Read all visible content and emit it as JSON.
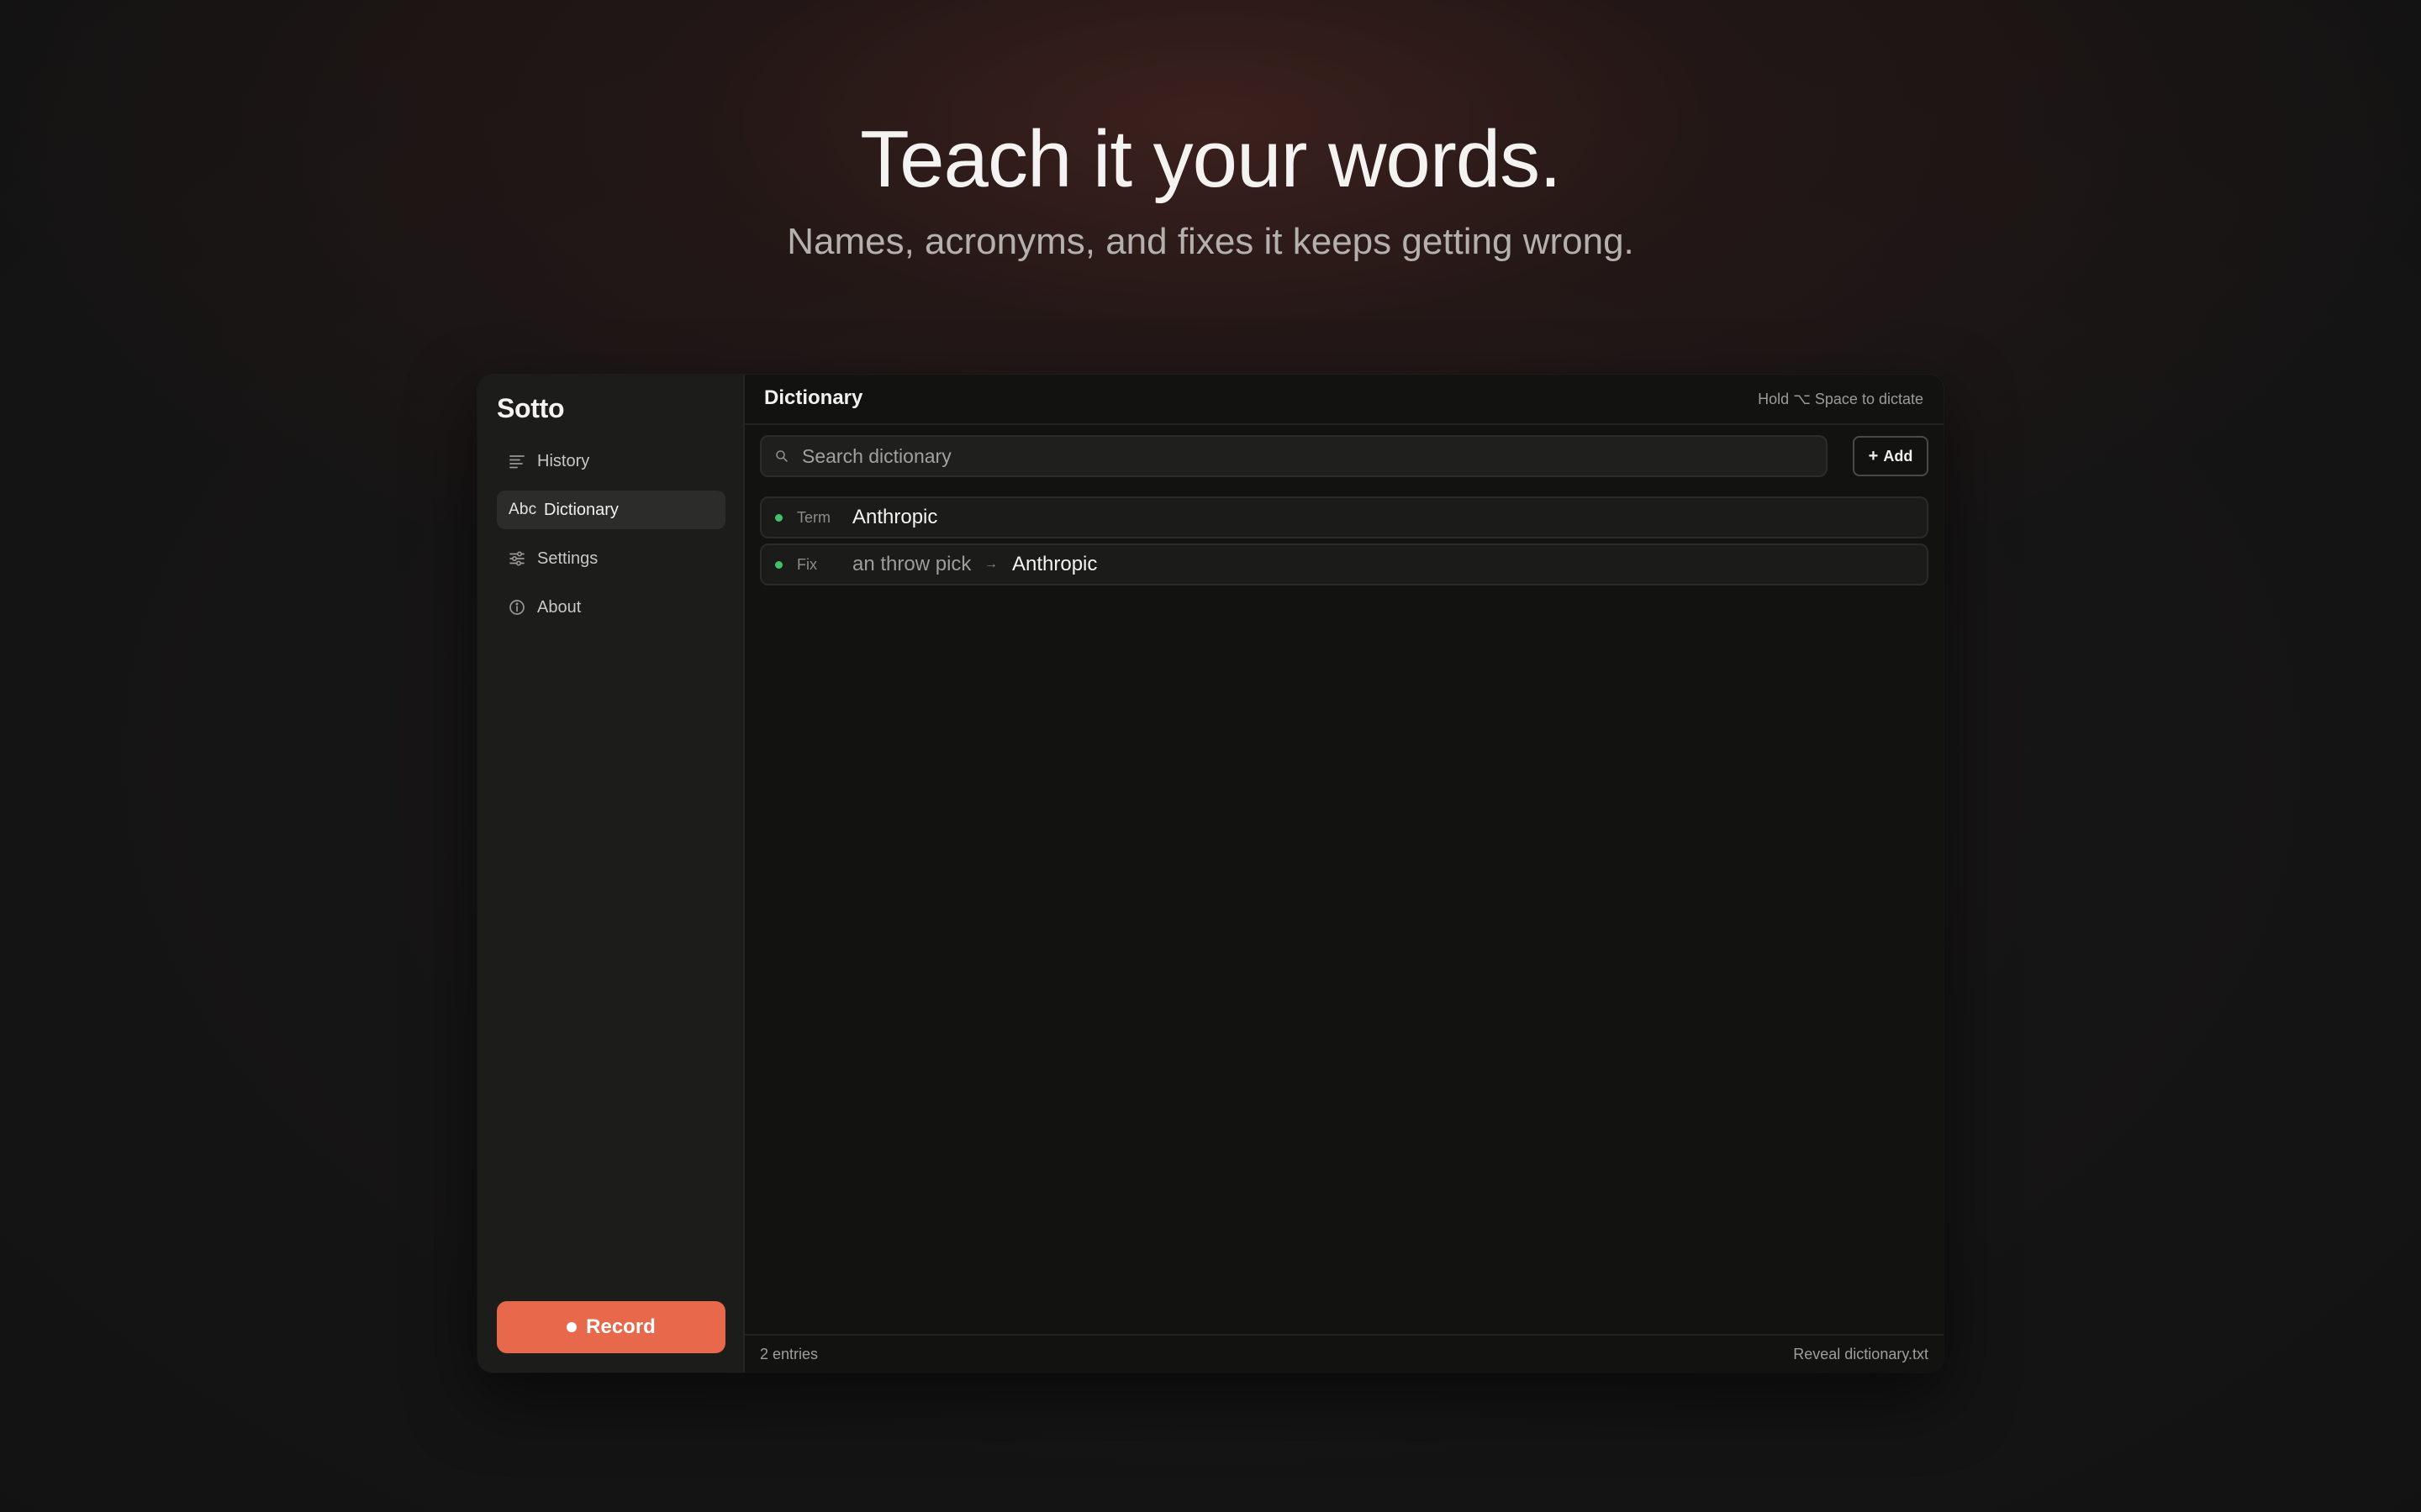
{
  "hero": {
    "title": "Teach it your words.",
    "subtitle": "Names, acronyms, and fixes it keeps getting wrong."
  },
  "app": {
    "name": "Sotto"
  },
  "sidebar": {
    "items": [
      {
        "label": "History",
        "icon": "list-lines-icon",
        "active": false
      },
      {
        "label": "Dictionary",
        "icon": "abc-icon",
        "icon_text": "Abc",
        "active": true
      },
      {
        "label": "Settings",
        "icon": "sliders-icon",
        "active": false
      },
      {
        "label": "About",
        "icon": "info-circle-icon",
        "active": false
      }
    ],
    "record_label": "Record"
  },
  "main": {
    "title": "Dictionary",
    "hint": "Hold ⌥ Space to dictate",
    "search_placeholder": "Search dictionary",
    "add_label": "Add",
    "add_symbol": "+",
    "entries": [
      {
        "type": "Term",
        "term": "Anthropic"
      },
      {
        "type": "Fix",
        "from": "an throw pick",
        "arrow": "→",
        "to": "Anthropic"
      }
    ],
    "footer": {
      "count": "2 entries",
      "reveal": "Reveal dictionary.txt"
    }
  },
  "colors": {
    "accent": "#e8684c",
    "status_dot": "#45c06a",
    "background": "#141414"
  }
}
